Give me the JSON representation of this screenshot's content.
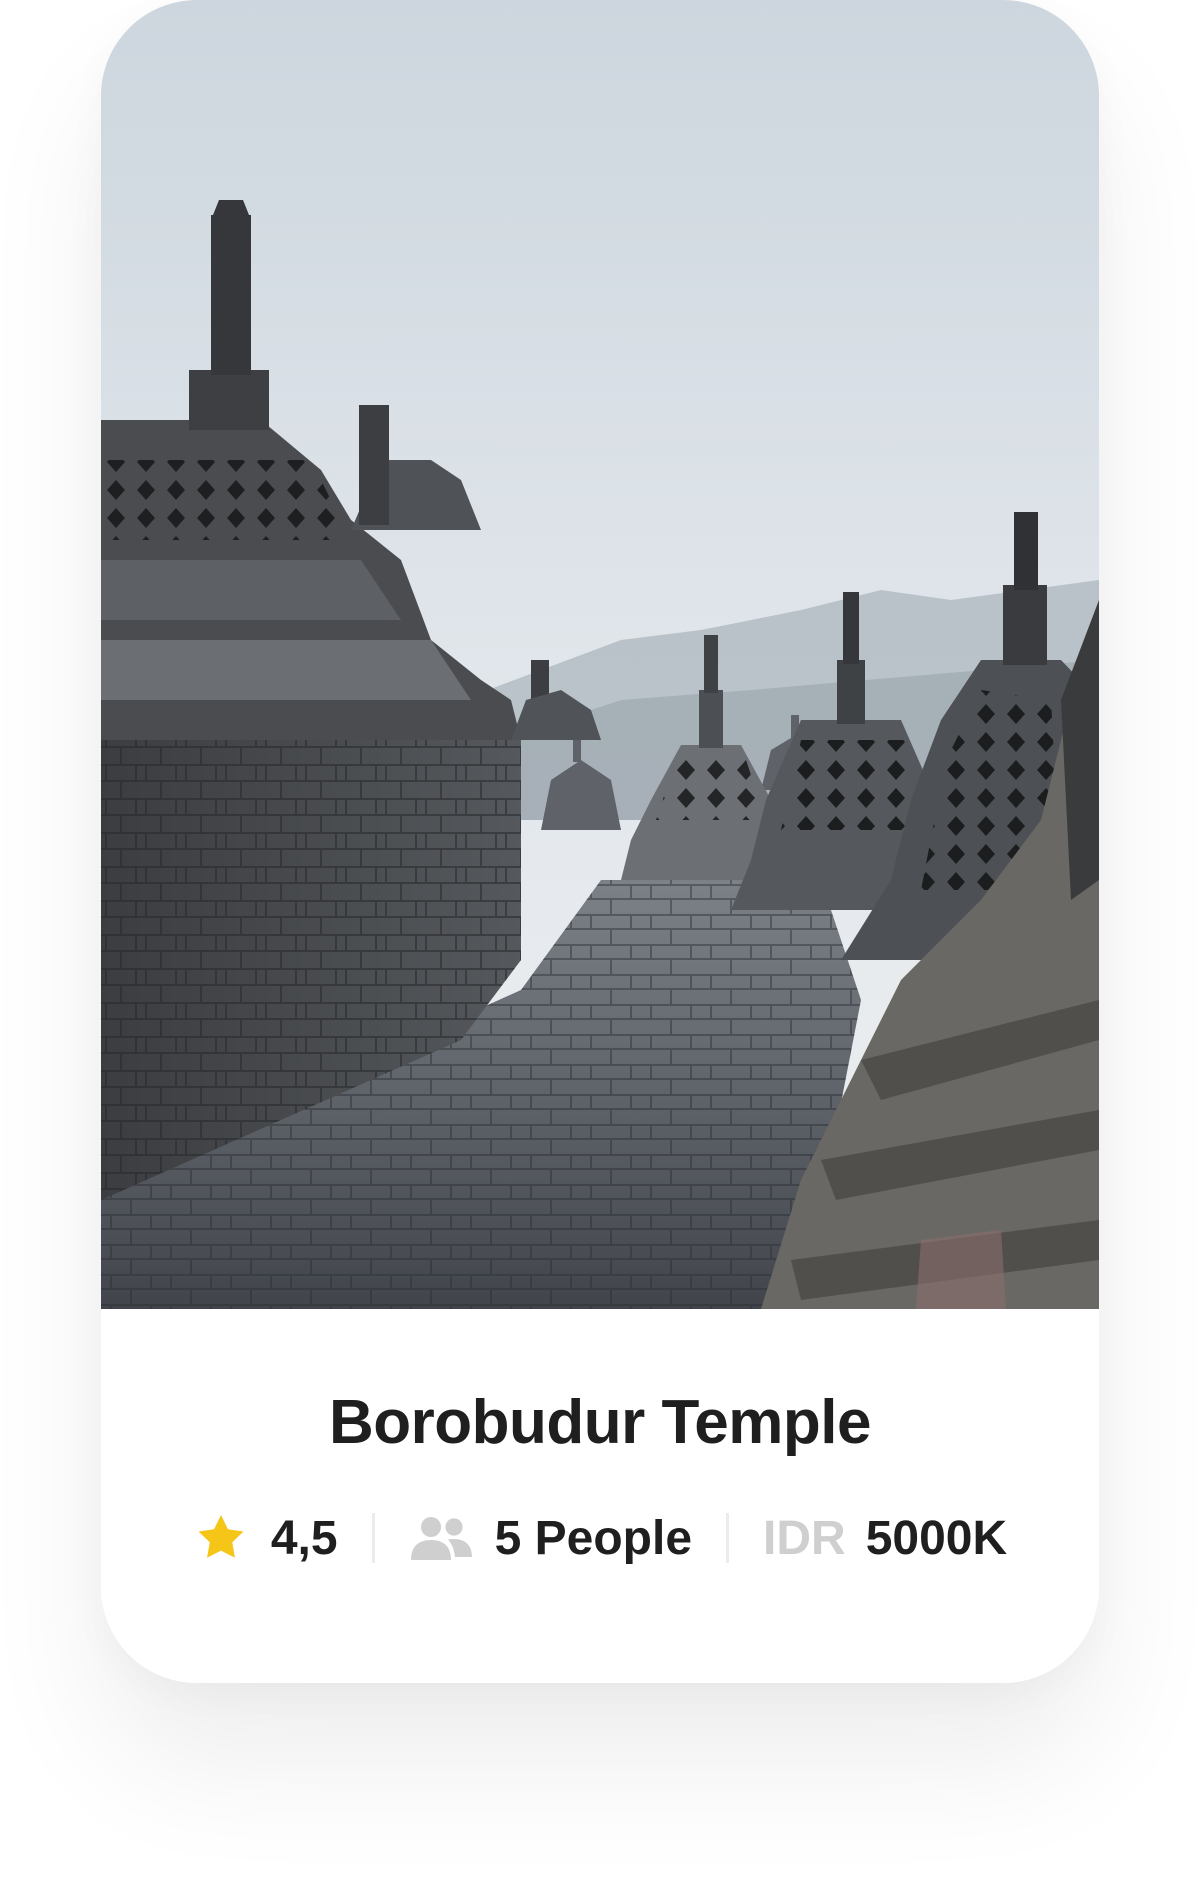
{
  "card": {
    "title": "Borobudur Temple",
    "image_icon": "borobudur-temple-photo",
    "rating": {
      "icon": "star-icon",
      "value": "4,5",
      "color": "#F5C518"
    },
    "capacity": {
      "icon": "people-icon",
      "value": "5 People",
      "icon_color": "#CFCFCF"
    },
    "price": {
      "currency": "IDR",
      "amount": "5000K",
      "currency_color": "#CFCFCF"
    }
  }
}
